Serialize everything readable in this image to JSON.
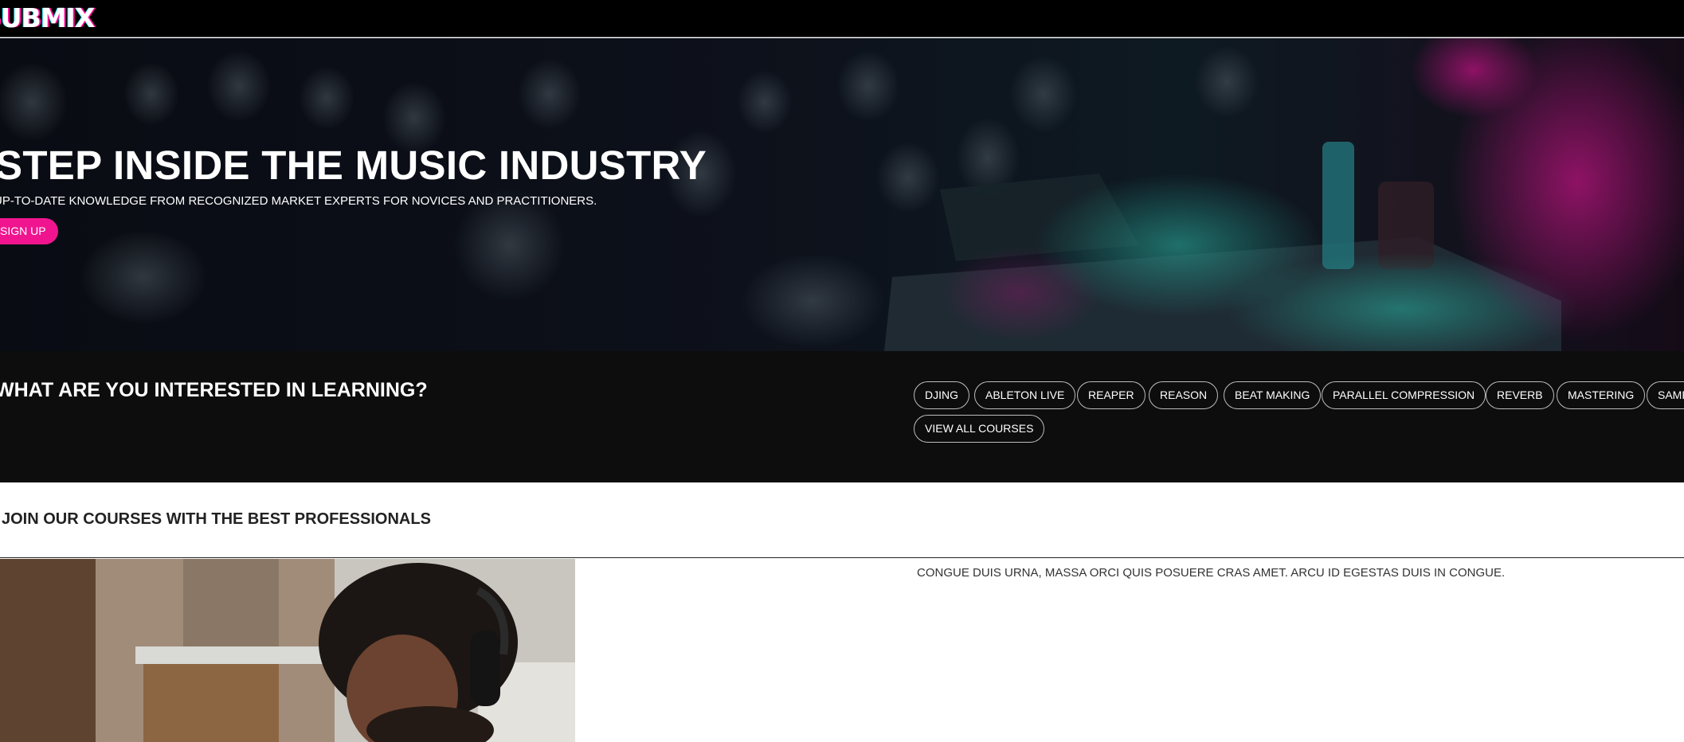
{
  "header": {
    "logo": "SUBMIX"
  },
  "hero": {
    "title": "STEP INSIDE THE MUSIC INDUSTRY",
    "subtitle": "UP-TO-DATE KNOWLEDGE FROM RECOGNIZED MARKET EXPERTS FOR NOVICES AND PRACTITIONERS.",
    "signup_label": "SIGN UP"
  },
  "interests": {
    "heading": "WHAT ARE YOU INTERESTED IN LEARNING?",
    "tags": [
      "DJING",
      "ABLETON LIVE",
      "REAPER",
      "REASON",
      "BEAT MAKING",
      "PARALLEL COMPRESSION",
      "REVERB",
      "MASTERING",
      "SAMPLING"
    ],
    "view_all_label": "VIEW ALL COURSES"
  },
  "professionals": {
    "heading": "JOIN OUR COURSES WITH THE BEST PROFESSIONALS",
    "caption": "CONGUE DUIS URNA, MASSA ORCI QUIS POSUERE CRAS AMET. ARCU ID EGESTAS DUIS IN CONGUE."
  },
  "colors": {
    "accent": "#f0158f",
    "header_bg": "#000000",
    "section_bg": "#0d0d0d"
  }
}
